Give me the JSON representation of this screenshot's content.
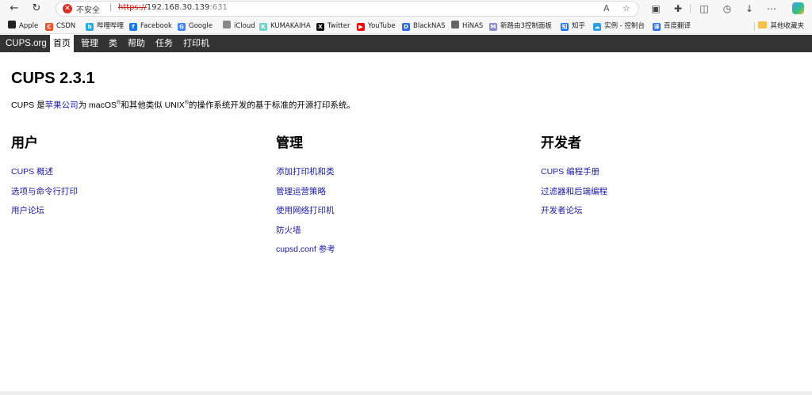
{
  "browser": {
    "insecure_label": "不安全",
    "separator": "|",
    "url_scheme": "https://",
    "url_host": "192.168.30.139",
    "url_port": ":631"
  },
  "bookmarks": [
    {
      "label": "Apple",
      "color": "#222222",
      "glyph": ""
    },
    {
      "label": "CSDN",
      "color": "#e9532d",
      "glyph": "C"
    },
    {
      "label": "哔哩哔哩",
      "color": "#23ade5",
      "glyph": "b"
    },
    {
      "label": "Facebook",
      "color": "#1877f2",
      "glyph": "f"
    },
    {
      "label": "Google",
      "color": "#4285f4",
      "glyph": "G"
    },
    {
      "label": "iCloud",
      "color": "#888888",
      "glyph": ""
    },
    {
      "label": "KUMAKAIHA",
      "color": "#6fd3c8",
      "glyph": "K"
    },
    {
      "label": "Twitter",
      "color": "#111111",
      "glyph": "X"
    },
    {
      "label": "YouTube",
      "color": "#ff0000",
      "glyph": "▶"
    },
    {
      "label": "BlackNAS",
      "color": "#2d6cdf",
      "glyph": "D"
    },
    {
      "label": "HiNAS",
      "color": "#666666",
      "glyph": ""
    },
    {
      "label": "新路由3控制面板",
      "color": "#8a8ad0",
      "glyph": "M"
    },
    {
      "label": "知乎",
      "color": "#1772f6",
      "glyph": "知"
    },
    {
      "label": "实例 - 控制台",
      "color": "#2e9fe6",
      "glyph": "☁"
    },
    {
      "label": "百度翻译",
      "color": "#2b6de5",
      "glyph": "译"
    }
  ],
  "bookmarks_folder": "其他收藏夹",
  "cups_nav": {
    "brand": "CUPS.org",
    "items": [
      "首页",
      "管理",
      "类",
      "帮助",
      "任务",
      "打印机"
    ]
  },
  "page": {
    "title": "CUPS 2.3.1",
    "intro_prefix": "CUPS 是",
    "intro_link": "苹果公司",
    "intro_mid1": "为 macOS",
    "intro_reg1": "®",
    "intro_mid2": "和其他类似 UNIX",
    "intro_reg2": "®",
    "intro_suffix": "的操作系统开发的基于标准的开源打印系统。"
  },
  "columns": [
    {
      "heading": "用户",
      "links": [
        "CUPS 概述",
        "选项与命令行打印",
        "用户论坛"
      ]
    },
    {
      "heading": "管理",
      "links": [
        "添加打印机和类",
        "管理运营策略",
        "使用网络打印机",
        "防火墙",
        "cupsd.conf 参考"
      ]
    },
    {
      "heading": "开发者",
      "links": [
        "CUPS 编程手册",
        "过滤器和后端编程",
        "开发者论坛"
      ]
    }
  ]
}
